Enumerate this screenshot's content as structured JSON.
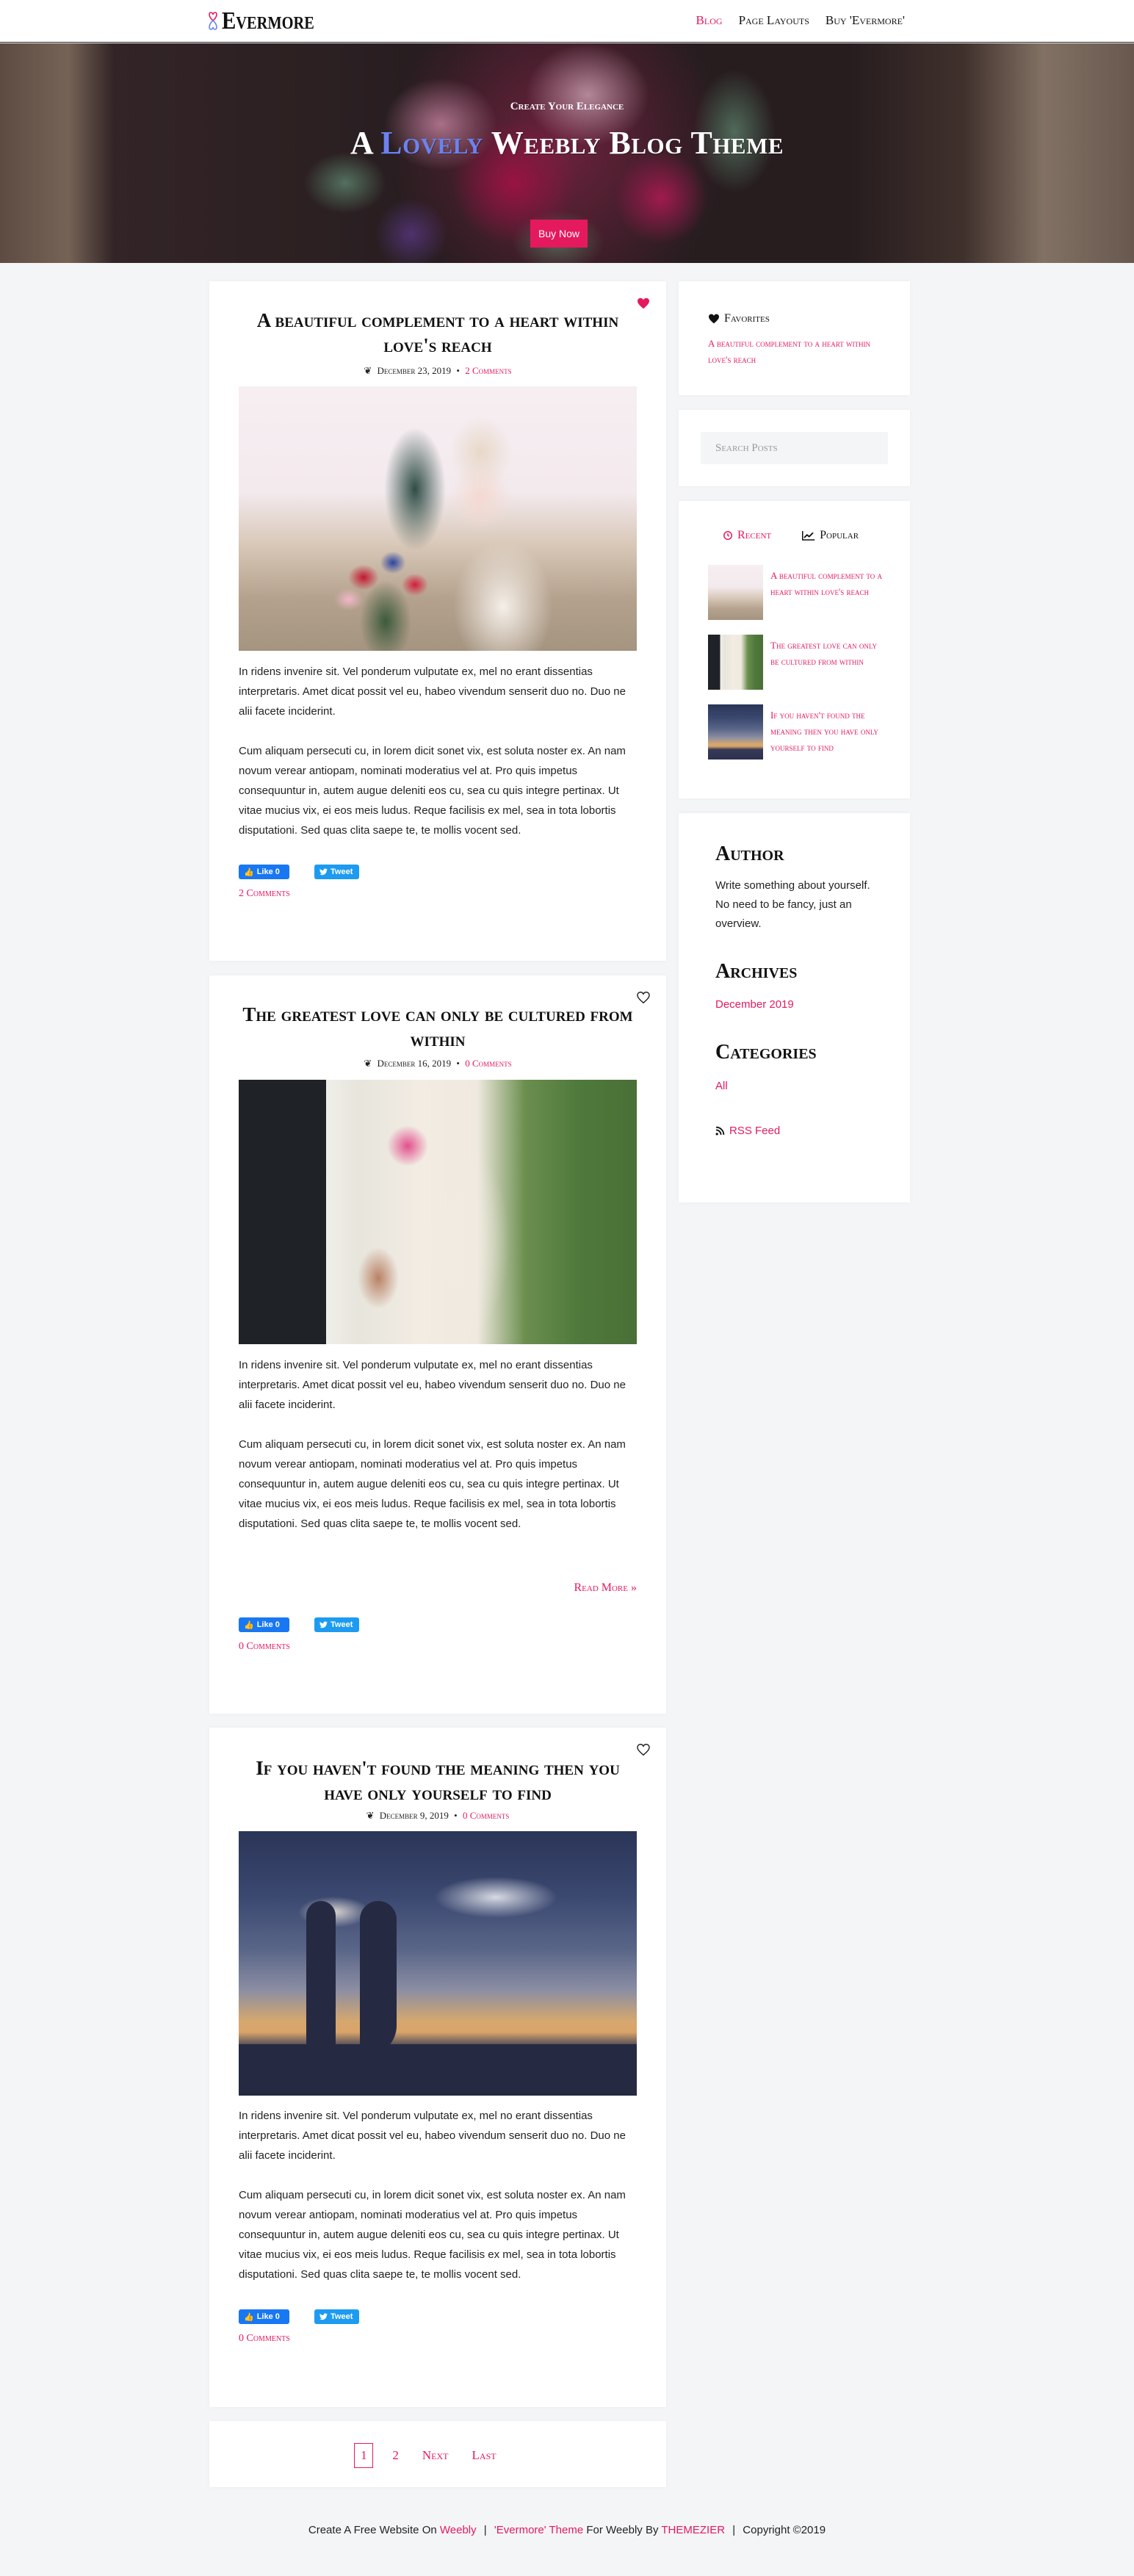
{
  "header": {
    "logo": "Evermore",
    "nav": [
      {
        "label": "Blog",
        "active": true
      },
      {
        "label": "Page Layouts",
        "active": false
      },
      {
        "label": "Buy 'Evermore'",
        "active": false
      }
    ]
  },
  "hero": {
    "kicker": "Create Your Elegance",
    "title_prefix": "A",
    "title_accent": "Lovely",
    "title_suffix": "Weebly Blog Theme",
    "button": "Buy Now"
  },
  "posts": [
    {
      "title": "A beautiful complement to a heart within love's reach",
      "date": "December 23, 2019",
      "comments": "2 Comments",
      "favorited": true,
      "image": "bride-with-bouquet",
      "paragraphs": [
        "In ridens invenire sit. Vel ponderum vulputate ex, mel no erant dissentias interpretaris. Amet dicat possit vel eu, habeo vivendum senserit duo no. Duo ne alii facete inciderint.",
        "Cum aliquam persecuti cu, in lorem dicit sonet vix, est soluta noster ex. An nam novum verear antiopam, nominati moderatius vel at. Pro quis impetus consequuntur in, autem augue deleniti eos cu, sea cu quis integre pertinax. Ut vitae mucius vix, ei eos meis ludus. Reque facilisis ex mel, sea in tota lobortis disputationi. Sed quas clita saepe te, te mollis vocent sed."
      ],
      "read_more": null,
      "like": "Like 0",
      "tweet": "Tweet"
    },
    {
      "title": "The greatest love can only be cultured from within",
      "date": "December 16, 2019",
      "comments": "0 Comments",
      "favorited": false,
      "image": "couple-holding-hands",
      "paragraphs": [
        "In ridens invenire sit. Vel ponderum vulputate ex, mel no erant dissentias interpretaris. Amet dicat possit vel eu, habeo vivendum senserit duo no. Duo ne alii facete inciderint.",
        "Cum aliquam persecuti cu, in lorem dicit sonet vix, est soluta noster ex. An nam novum verear antiopam, nominati moderatius vel at. Pro quis impetus consequuntur in, autem augue deleniti eos cu, sea cu quis integre pertinax. Ut vitae mucius vix, ei eos meis ludus. Reque facilisis ex mel, sea in tota lobortis disputationi. Sed quas clita saepe te, te mollis vocent sed."
      ],
      "read_more": "Read More »",
      "like": "Like 0",
      "tweet": "Tweet"
    },
    {
      "title": "If you haven't found the meaning then you have only yourself to find",
      "date": "December 9, 2019",
      "comments": "0 Comments",
      "favorited": false,
      "image": "couple-silhouette-sunset",
      "paragraphs": [
        "In ridens invenire sit. Vel ponderum vulputate ex, mel no erant dissentias interpretaris. Amet dicat possit vel eu, habeo vivendum senserit duo no. Duo ne alii facete inciderint.",
        "Cum aliquam persecuti cu, in lorem dicit sonet vix, est soluta noster ex. An nam novum verear antiopam, nominati moderatius vel at. Pro quis impetus consequuntur in, autem augue deleniti eos cu, sea cu quis integre pertinax. Ut vitae mucius vix, ei eos meis ludus. Reque facilisis ex mel, sea in tota lobortis disputationi. Sed quas clita saepe te, te mollis vocent sed."
      ],
      "read_more": null,
      "like": "Like 0",
      "tweet": "Tweet"
    }
  ],
  "sidebar": {
    "favorites": {
      "title": "Favorites",
      "items": [
        "A beautiful complement to a heart within love's reach"
      ]
    },
    "search": {
      "placeholder": "Search Posts"
    },
    "tabs": [
      {
        "label": "Recent",
        "icon": "history-icon",
        "active": true
      },
      {
        "label": "Popular",
        "icon": "chart-line-icon",
        "active": false
      }
    ],
    "recent": [
      {
        "title": "A beautiful complement to a heart within love's reach"
      },
      {
        "title": "The greatest love can only be cultured from within"
      },
      {
        "title": "If you haven't found the meaning then you have only yourself to find"
      }
    ],
    "author": {
      "title": "Author",
      "text": "Write something about yourself. No need to be fancy, just an overview."
    },
    "archives": {
      "title": "Archives",
      "items": [
        "December 2019"
      ]
    },
    "categories": {
      "title": "Categories",
      "items": [
        "All"
      ]
    },
    "rss": "RSS Feed"
  },
  "pagination": {
    "current": "1",
    "pages": [
      "2"
    ],
    "next": "Next",
    "last": "Last"
  },
  "footer": {
    "part1": "Create A Free Website On",
    "link1": "Weebly",
    "sep": "|",
    "link2": "'Evermore' Theme",
    "part2": "For Weebly By",
    "link3": "THEMEZIER",
    "part3": "Copyright ©2019"
  },
  "colors": {
    "accent": "#e5195e",
    "hero_accent": "#6b82f0",
    "background": "#f4f5f7"
  }
}
